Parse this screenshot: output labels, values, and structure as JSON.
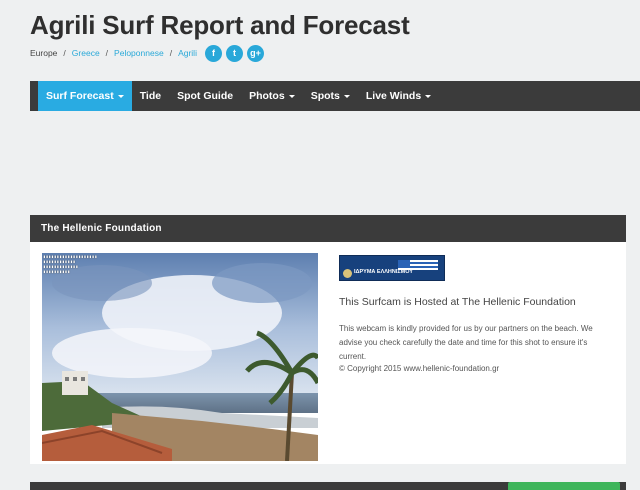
{
  "page_title": "Agrili Surf Report and Forecast",
  "breadcrumb": {
    "items": [
      "Europe",
      "Greece",
      "Peloponnese",
      "Agrili"
    ],
    "separator": "/"
  },
  "social": {
    "facebook": "f",
    "twitter": "t",
    "googleplus": "g+"
  },
  "nav": {
    "items": [
      {
        "label": "Surf Forecast",
        "dropdown": true,
        "active": true
      },
      {
        "label": "Tide",
        "dropdown": false
      },
      {
        "label": "Spot Guide",
        "dropdown": false
      },
      {
        "label": "Photos",
        "dropdown": true
      },
      {
        "label": "Spots",
        "dropdown": true
      },
      {
        "label": "Live Winds",
        "dropdown": true
      }
    ]
  },
  "panel": {
    "title": "The Hellenic Foundation",
    "host_title": "This Surfcam is Hosted at The Hellenic Foundation",
    "description": "This webcam is kindly provided for us by our partners on the beach. We advise you check carefully the date and time for this shot to ensure it's current.",
    "copyright": "© Copyright 2015 www.hellenic-foundation.gr",
    "banner_main": "ΙΔΡΥΜΑ ΕΛΛΗΝΙΣΜΟΥ"
  },
  "colors": {
    "nav_bg": "#3b3b3b",
    "accent": "#29abe2",
    "green": "#3eb55b"
  }
}
